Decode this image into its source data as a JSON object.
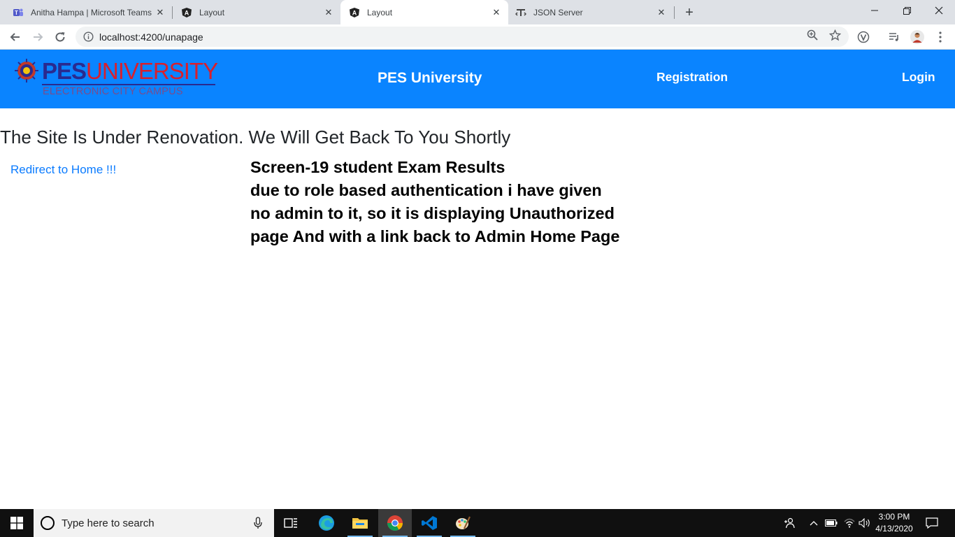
{
  "browser": {
    "tabs": [
      {
        "title": "Anitha Hampa | Microsoft Teams",
        "icon": "teams-icon",
        "active": false
      },
      {
        "title": "Layout",
        "icon": "angular-icon",
        "active": false
      },
      {
        "title": "Layout",
        "icon": "angular-icon",
        "active": true
      },
      {
        "title": "JSON Server",
        "icon": "json-server-icon",
        "active": false
      }
    ],
    "url": "localhost:4200/unapage"
  },
  "header": {
    "logo": {
      "main_pes": "PES",
      "main_university": "UNIVERSITY",
      "subtitle": "ELECTRONIC CITY CAMPUS"
    },
    "title": "PES University",
    "nav": {
      "registration": "Registration",
      "login": "Login"
    },
    "background_color": "#0a84ff"
  },
  "main": {
    "renovation_message": "The Site Is Under Renovation. We Will Get Back To You Shortly",
    "redirect_link": "Redirect to Home !!!",
    "annotation_lines": [
      "Screen-19 student Exam Results",
      "due to role based authentication i have given",
      "no admin to it, so it is displaying Unauthorized",
      "page And with a link back to Admin Home Page"
    ]
  },
  "taskbar": {
    "search_placeholder": "Type here to search",
    "apps": [
      "task-view-icon",
      "edge-icon",
      "file-explorer-icon",
      "chrome-icon",
      "vscode-icon",
      "paint-icon"
    ],
    "time": "3:00 PM",
    "date": "4/13/2020"
  }
}
